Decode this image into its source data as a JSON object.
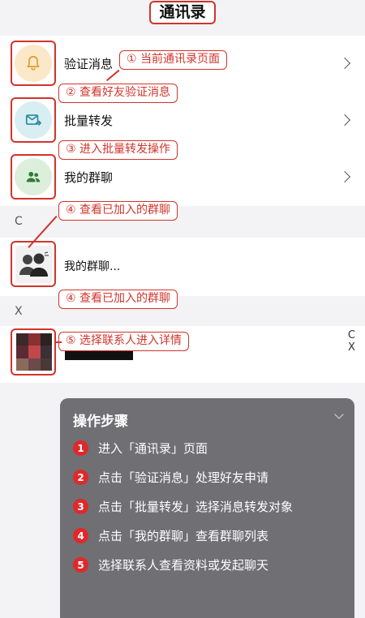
{
  "header": {
    "title": "通讯录"
  },
  "rows": {
    "verify": {
      "label": "验证消息"
    },
    "batch": {
      "label": "批量转发"
    },
    "groups": {
      "label": "我的群聊"
    }
  },
  "sections": [
    {
      "letter": "C",
      "contact_name": "我的群聊..."
    },
    {
      "letter": "X"
    }
  ],
  "right_index": [
    "C",
    "X"
  ],
  "callouts": {
    "c1": "① 当前通讯录页面",
    "c2": "② 查看好友验证消息",
    "c3": "③ 进入批量转发操作",
    "c4a": "④ 查看已加入的群聊",
    "c4b": "④ 查看已加入的群聊",
    "c5": "⑤ 选择联系人进入详情"
  },
  "panel": {
    "title": "操作步骤",
    "steps": [
      {
        "num": "1",
        "text": "进入「通讯录」页面"
      },
      {
        "num": "2",
        "text": "点击「验证消息」处理好友申请"
      },
      {
        "num": "3",
        "text": "点击「批量转发」选择消息转发对象"
      },
      {
        "num": "4",
        "text": "点击「我的群聊」查看群聊列表"
      },
      {
        "num": "5",
        "text": "选择联系人查看资料或发起聊天"
      }
    ]
  },
  "colors": {
    "accent_red": "#d0342c",
    "bell_bg": "#fbe8c8",
    "mail_bg": "#d8eef2",
    "group_bg": "#dcefdc",
    "panel_bg": "#6f6f74"
  },
  "icons": {
    "verify": "bell-icon",
    "batch": "mail-forward-icon",
    "groups": "group-icon",
    "section_c": "group-avatar-icon",
    "section_x": "contact-avatar-icon"
  }
}
